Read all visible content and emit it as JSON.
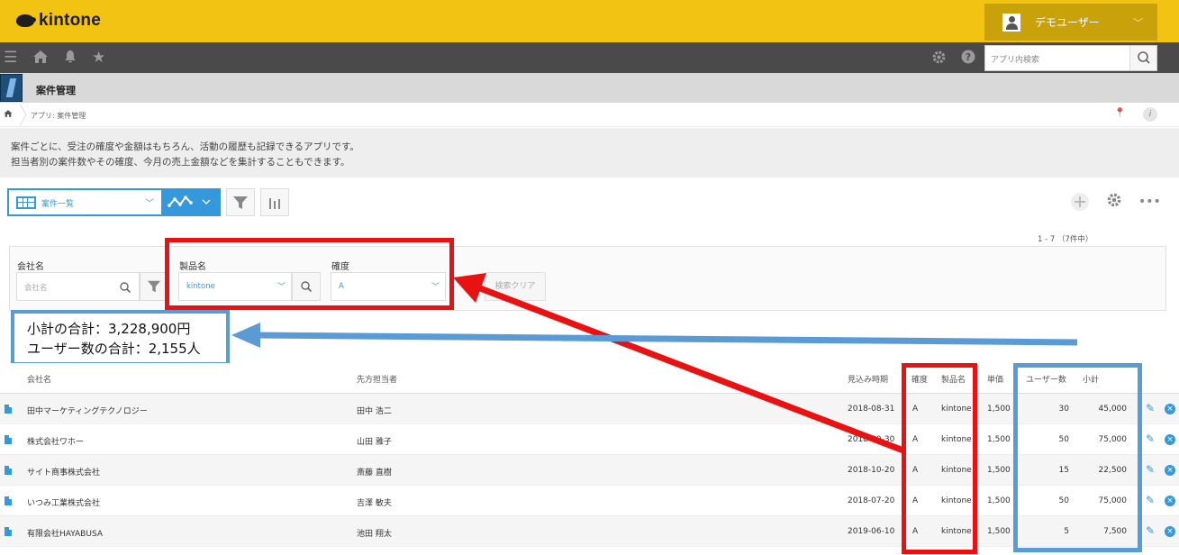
{
  "topbar": {
    "logo": "kintone",
    "user_name": "デモユーザー"
  },
  "search": {
    "placeholder": "アプリ内検索"
  },
  "app": {
    "title": "案件管理",
    "breadcrumb": "アプリ: 案件管理"
  },
  "description": {
    "line1": "案件ごとに、受注の確度や金額はもちろん、活動の履歴も記録できるアプリです。",
    "line2": "担当者別の案件数やその確度、今月の売上金額などを集計することもできます。"
  },
  "toolbar": {
    "view_name": "案件一覧",
    "record_count": "1 - 7 （7件中）"
  },
  "filters": {
    "company": {
      "label": "会社名",
      "placeholder": "会社名"
    },
    "product": {
      "label": "製品名",
      "value": "kintone"
    },
    "certainty": {
      "label": "確度",
      "value": "A"
    },
    "clear_label": "検索クリア"
  },
  "summary": {
    "subtotal": "小計の合計：3,228,900円",
    "users": "ユーザー数の合計：2,155人"
  },
  "table": {
    "headers": {
      "company": "会社名",
      "contact": "先方担当者",
      "date": "見込み時期",
      "certainty": "確度",
      "product": "製品名",
      "price": "単価",
      "users": "ユーザー数",
      "subtotal": "小計"
    },
    "rows": [
      {
        "company": "田中マーケティングテクノロジー",
        "contact": "田中 浩二",
        "date": "2018-08-31",
        "certainty": "A",
        "product": "kintone",
        "price": "1,500",
        "users": "30",
        "subtotal": "45,000"
      },
      {
        "company": "株式会社ワホー",
        "contact": "山田 雅子",
        "date": "2018-09-30",
        "certainty": "A",
        "product": "kintone",
        "price": "1,500",
        "users": "50",
        "subtotal": "75,000"
      },
      {
        "company": "サイト商事株式会社",
        "contact": "斎藤 直樹",
        "date": "2018-10-20",
        "certainty": "A",
        "product": "kintone",
        "price": "1,500",
        "users": "15",
        "subtotal": "22,500"
      },
      {
        "company": "いつみ工業株式会社",
        "contact": "吉澤 敏夫",
        "date": "2018-07-20",
        "certainty": "A",
        "product": "kintone",
        "price": "1,500",
        "users": "50",
        "subtotal": "75,000"
      },
      {
        "company": "有限会社HAYABUSA",
        "contact": "池田 翔太",
        "date": "2019-06-10",
        "certainty": "A",
        "product": "kintone",
        "price": "1,500",
        "users": "5",
        "subtotal": "7,500"
      }
    ]
  },
  "colors": {
    "brand": "#f3c313",
    "nav": "#4a4a4a",
    "accent": "#3498db",
    "annotation_red": "#e81212",
    "annotation_blue": "#5b9bd5"
  },
  "icons": [
    "menu-icon",
    "home-icon",
    "bell-icon",
    "star-icon",
    "gear-icon",
    "help-icon",
    "search-icon",
    "filter-icon",
    "graph-icon",
    "plus-icon",
    "more-icon",
    "document-icon",
    "pencil-icon",
    "delete-icon"
  ]
}
